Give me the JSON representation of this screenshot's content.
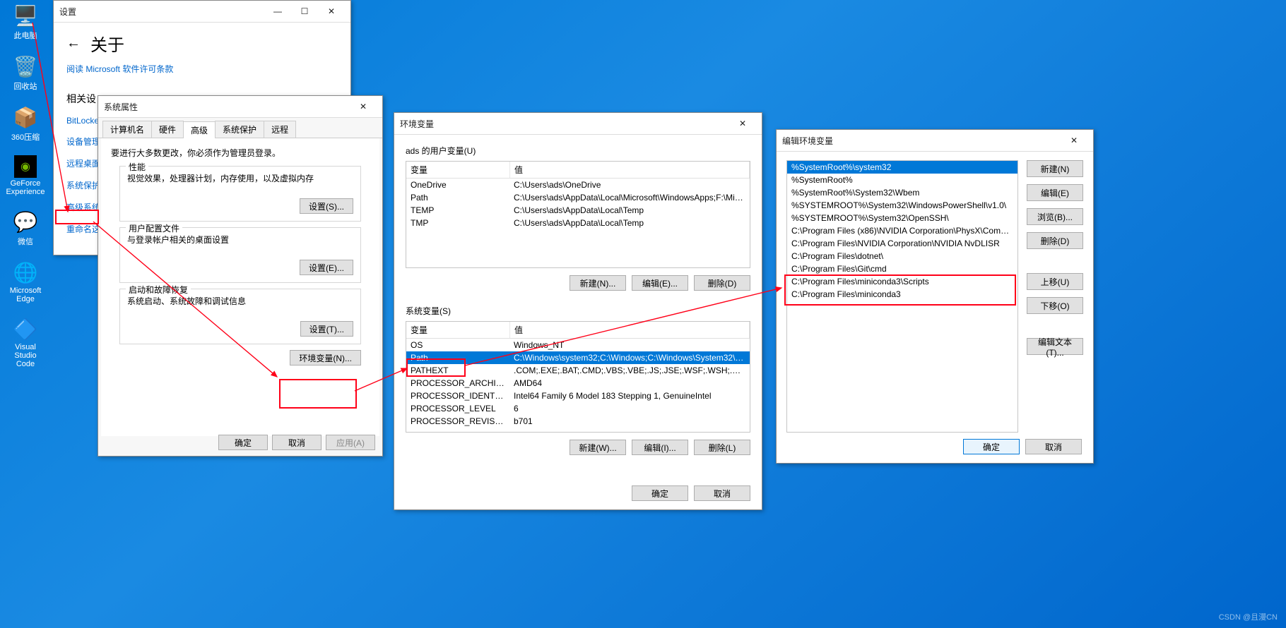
{
  "desktop_icons": [
    {
      "label": "此电脑",
      "emoji": "🖥️"
    },
    {
      "label": "回收站",
      "emoji": "🗑️"
    },
    {
      "label": "360压缩",
      "emoji": "📦"
    },
    {
      "label": "GeForce Experience",
      "emoji": "🟩"
    },
    {
      "label": "微信",
      "emoji": "💬"
    },
    {
      "label": "Microsoft Edge",
      "emoji": "🌐"
    },
    {
      "label": "Visual Studio Code",
      "emoji": "🔷"
    }
  ],
  "settings": {
    "title": "设置",
    "back": "←",
    "header": "关于",
    "link": "阅读 Microsoft 软件许可条款",
    "section": "相关设",
    "items": [
      "BitLocker",
      "设备管理器",
      "远程桌面",
      "系统保护",
      "高级系统设",
      "重命名这台"
    ]
  },
  "sysprops": {
    "title": "系统属性",
    "tabs": [
      "计算机名",
      "硬件",
      "高级",
      "系统保护",
      "远程"
    ],
    "admin_note": "要进行大多数更改，你必须作为管理员登录。",
    "perf": {
      "legend": "性能",
      "desc": "视觉效果，处理器计划，内存使用，以及虚拟内存",
      "btn": "设置(S)..."
    },
    "profile": {
      "legend": "用户配置文件",
      "desc": "与登录帐户相关的桌面设置",
      "btn": "设置(E)..."
    },
    "startup": {
      "legend": "启动和故障恢复",
      "desc": "系统启动、系统故障和调试信息",
      "btn": "设置(T)..."
    },
    "envbtn": "环境变量(N)...",
    "ok": "确定",
    "cancel": "取消",
    "apply": "应用(A)"
  },
  "env": {
    "title": "环境变量",
    "user_label": "ads 的用户变量(U)",
    "col_var": "变量",
    "col_val": "值",
    "user_vars": [
      {
        "n": "OneDrive",
        "v": "C:\\Users\\ads\\OneDrive"
      },
      {
        "n": "Path",
        "v": "C:\\Users\\ads\\AppData\\Local\\Microsoft\\WindowsApps;F:\\Mic..."
      },
      {
        "n": "TEMP",
        "v": "C:\\Users\\ads\\AppData\\Local\\Temp"
      },
      {
        "n": "TMP",
        "v": "C:\\Users\\ads\\AppData\\Local\\Temp"
      }
    ],
    "sys_label": "系统变量(S)",
    "sys_vars": [
      {
        "n": "OS",
        "v": "Windows_NT"
      },
      {
        "n": "Path",
        "v": "C:\\Windows\\system32;C:\\Windows;C:\\Windows\\System32\\Wb..."
      },
      {
        "n": "PATHEXT",
        "v": ".COM;.EXE;.BAT;.CMD;.VBS;.VBE;.JS;.JSE;.WSF;.WSH;.MSC"
      },
      {
        "n": "PROCESSOR_ARCHITECT...",
        "v": "AMD64"
      },
      {
        "n": "PROCESSOR_IDENTIFIER",
        "v": "Intel64 Family 6 Model 183 Stepping 1, GenuineIntel"
      },
      {
        "n": "PROCESSOR_LEVEL",
        "v": "6"
      },
      {
        "n": "PROCESSOR_REVISION",
        "v": "b701"
      }
    ],
    "new": "新建(N)...",
    "edit": "编辑(E)...",
    "del": "删除(D)",
    "new2": "新建(W)...",
    "edit2": "编辑(I)...",
    "del2": "删除(L)",
    "ok": "确定",
    "cancel": "取消"
  },
  "editenv": {
    "title": "编辑环境变量",
    "entries": [
      "%SystemRoot%\\system32",
      "%SystemRoot%",
      "%SystemRoot%\\System32\\Wbem",
      "%SYSTEMROOT%\\System32\\WindowsPowerShell\\v1.0\\",
      "%SYSTEMROOT%\\System32\\OpenSSH\\",
      "C:\\Program Files (x86)\\NVIDIA Corporation\\PhysX\\Common",
      "C:\\Program Files\\NVIDIA Corporation\\NVIDIA NvDLISR",
      "C:\\Program Files\\dotnet\\",
      "C:\\Program Files\\Git\\cmd",
      "C:\\Program Files\\miniconda3\\Scripts",
      "C:\\Program Files\\miniconda3"
    ],
    "btns": {
      "new": "新建(N)",
      "edit": "编辑(E)",
      "browse": "浏览(B)...",
      "del": "删除(D)",
      "up": "上移(U)",
      "down": "下移(O)",
      "text": "编辑文本(T)..."
    },
    "ok": "确定",
    "cancel": "取消"
  },
  "watermark": "CSDN @且漫CN"
}
